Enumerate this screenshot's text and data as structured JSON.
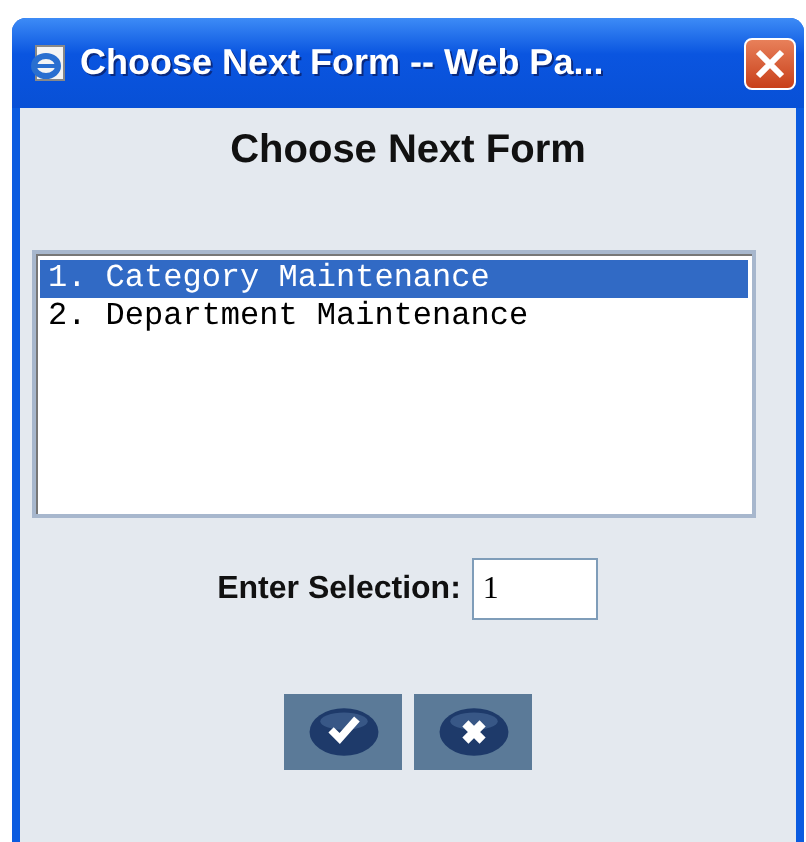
{
  "window": {
    "title": "Choose Next Form -- Web Pa..."
  },
  "heading": "Choose Next Form",
  "options": [
    {
      "label": "1. Category Maintenance",
      "selected": true
    },
    {
      "label": "2. Department Maintenance",
      "selected": false
    }
  ],
  "selection": {
    "label": "Enter Selection:",
    "value": "1"
  },
  "buttons": [
    {
      "kind": "ok"
    },
    {
      "kind": "cancel"
    }
  ]
}
